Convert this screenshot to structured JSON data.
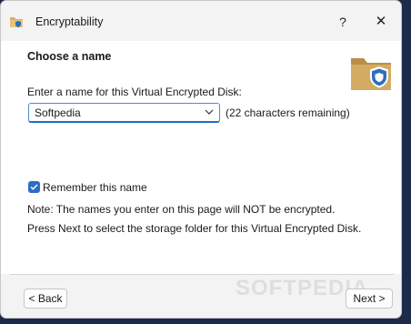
{
  "window": {
    "title": "Encryptability",
    "help_glyph": "?",
    "close_glyph": "✕"
  },
  "page": {
    "heading": "Choose a name",
    "prompt": "Enter a name for this Virtual Encrypted Disk:",
    "name_value": "Softpedia",
    "remaining": "(22 characters remaining)",
    "remember_label": "Remember this name",
    "remember_checked": true,
    "note": "Note: The names you enter on this page will NOT be encrypted.",
    "instruction": "Press Next to select the storage folder for this Virtual Encrypted Disk."
  },
  "buttons": {
    "back": "< Back",
    "next": "Next >"
  },
  "watermark": "SOFTPEDIA",
  "colors": {
    "accent": "#2b6fc4",
    "folder": "#c9a25a",
    "shield": "#2f6fb8"
  }
}
